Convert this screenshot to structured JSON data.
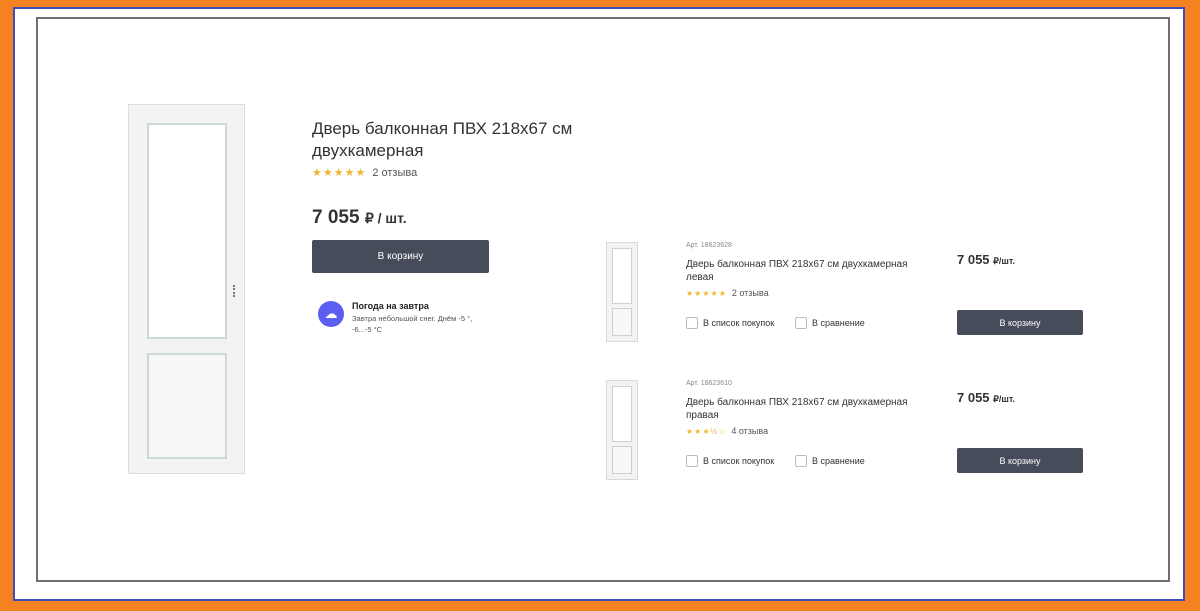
{
  "product": {
    "title": "Дверь балконная ПВХ 218x67 см двухкамерная",
    "stars": "★★★★★",
    "reviews": "2 отзыва",
    "price": "7 055",
    "price_unit": "₽ / шт.",
    "cart_label": "В корзину"
  },
  "weather": {
    "title": "Погода на завтра",
    "text": "Завтра небольшой снег. Днём -5 °, -6...-5 °C"
  },
  "variants": [
    {
      "article": "Арт. 18623628",
      "title": "Дверь балконная ПВХ 218x67 см двухкамерная левая",
      "stars": "★★★★★",
      "reviews": "2 отзыва",
      "shopping_list": "В список покупок",
      "compare": "В сравнение",
      "price": "7 055",
      "price_unit": "₽/шт.",
      "cart_label": "В корзину"
    },
    {
      "article": "Арт. 18623610",
      "title": "Дверь балконная ПВХ 218x67 см двухкамерная правая",
      "stars": "★★★½☆",
      "reviews": "4 отзыва",
      "shopping_list": "В список покупок",
      "compare": "В сравнение",
      "price": "7 055",
      "price_unit": "₽/шт.",
      "cart_label": "В корзину"
    }
  ],
  "colors": {
    "accent": "#f58220",
    "button": "#474c5a",
    "star": "#f2b531",
    "weather_icon": "#5b5ef0"
  }
}
